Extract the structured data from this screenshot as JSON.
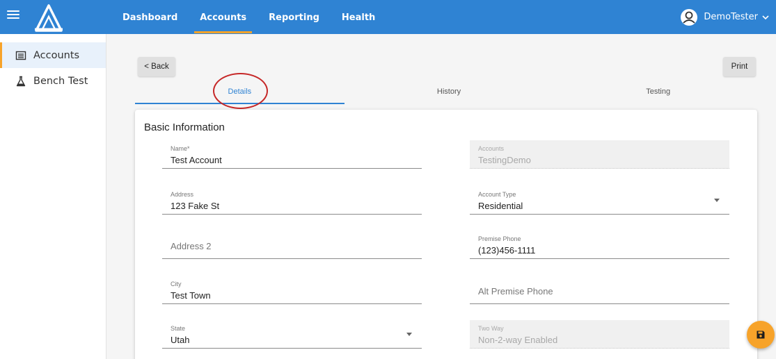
{
  "header": {
    "nav": [
      {
        "label": "Dashboard"
      },
      {
        "label": "Accounts"
      },
      {
        "label": "Reporting"
      },
      {
        "label": "Health"
      }
    ],
    "user_name": "DemoTester"
  },
  "sidebar": {
    "items": [
      {
        "label": "Accounts",
        "icon": "list-icon"
      },
      {
        "label": "Bench Test",
        "icon": "flask-icon"
      }
    ]
  },
  "toolbar": {
    "back_label": "< Back",
    "print_label": "Print"
  },
  "tabs": [
    {
      "label": "Details"
    },
    {
      "label": "History"
    },
    {
      "label": "Testing"
    }
  ],
  "form": {
    "title": "Basic Information",
    "name": {
      "label": "Name*",
      "value": "Test Account"
    },
    "accounts": {
      "label": "Accounts",
      "value": "TestingDemo"
    },
    "address": {
      "label": "Address",
      "value": "123 Fake St"
    },
    "account_type": {
      "label": "Account Type",
      "value": "Residential"
    },
    "address2": {
      "placeholder": "Address 2"
    },
    "premise_phone": {
      "label": "Premise Phone",
      "value": "(123)456-1111"
    },
    "city": {
      "label": "City",
      "value": "Test Town"
    },
    "alt_phone": {
      "placeholder": "Alt Premise Phone"
    },
    "state": {
      "label": "State",
      "value": "Utah"
    },
    "two_way": {
      "label": "Two Way",
      "value": "Non-2-way Enabled"
    }
  },
  "colors": {
    "header_bg": "#2f83d3",
    "accent": "#f7a32a",
    "annotation": "#c62828"
  }
}
